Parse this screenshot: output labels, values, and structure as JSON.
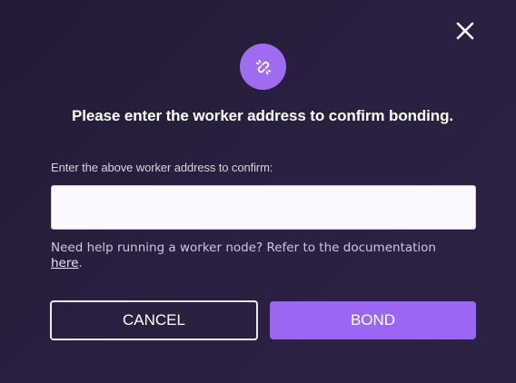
{
  "dialog": {
    "title": "Please enter the worker address to confirm bonding.",
    "field_label": "Enter the above worker address to confirm:",
    "address_value": "",
    "address_placeholder": "",
    "help_text": "Need help running a worker node? Refer to the documentation ",
    "help_link": "here",
    "help_suffix": ".",
    "cancel_label": "CANCEL",
    "bond_label": "BOND",
    "icons": {
      "close": "close-icon",
      "badge": "link-icon"
    },
    "colors": {
      "accent": "#9a66f2",
      "badge": "#9e6cf0",
      "background": "#2b2040"
    }
  }
}
